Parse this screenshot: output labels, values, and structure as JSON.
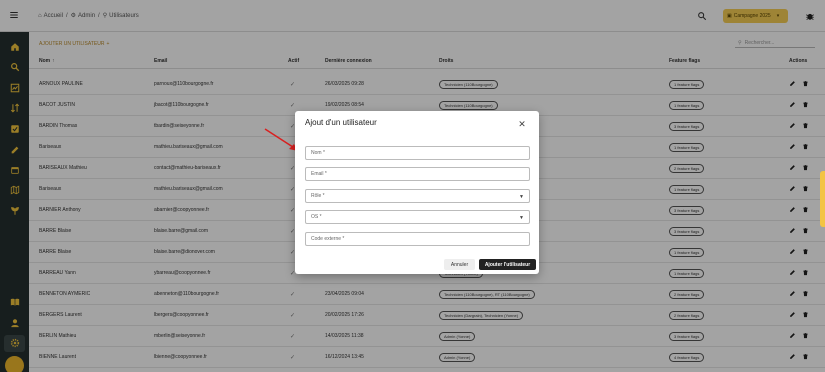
{
  "breadcrumb": {
    "home": "Accueil",
    "admin": "Admin",
    "users": "Utilisateurs"
  },
  "topbar": {
    "campaign_label": "Campagne 2025"
  },
  "toolbar": {
    "add_user_label": "AJOUTER UN UTILISATEUR",
    "search_placeholder": "Rechercher..."
  },
  "table": {
    "headers": {
      "name": "Nom",
      "email": "Email",
      "active": "Actif",
      "last_login": "Dernière connexion",
      "rights": "Droits",
      "flags": "Feature flags",
      "actions": "Actions"
    },
    "rows": [
      {
        "name": "ARNOUX PAULINE",
        "email": "parnoux@110bourgogne.fr",
        "active": "✓",
        "last_login": "26/03/2025 09:28",
        "rights": [
          "Technicien (110Bourgogne)"
        ],
        "flags": "1 feature flags"
      },
      {
        "name": "BACOT JUSTIN",
        "email": "jbacot@110bourgogne.fr",
        "active": "✓",
        "last_login": "19/02/2025 08:54",
        "rights": [
          "Technicien (110Bourgogne)"
        ],
        "flags": "1 feature flags"
      },
      {
        "name": "BARDIN Thomas",
        "email": "tbardin@seiseyonne.fr",
        "active": "✓",
        "last_login": "",
        "rights": [],
        "flags": "3 feature flags"
      },
      {
        "name": "Bariseaux",
        "email": "mathieu.bariseaux@gmail.com",
        "active": "✓",
        "last_login": "",
        "rights": [],
        "flags": "1 feature flags"
      },
      {
        "name": "BARISEAUX Mathieu",
        "email": "contact@mathieu-bariseaux.fr",
        "active": "✓",
        "last_login": "",
        "rights": [],
        "flags": "2 feature flags"
      },
      {
        "name": "Bariseaux",
        "email": "mathieu.bariseaux@gmail.com",
        "active": "✓",
        "last_login": "",
        "rights": [],
        "flags": "1 feature flags"
      },
      {
        "name": "BARNIER Anthony",
        "email": "abarnier@coopyonnee.fr",
        "active": "✓",
        "last_login": "",
        "rights": [],
        "flags": "3 feature flags"
      },
      {
        "name": "BARRE Blaise",
        "email": "blaise.barre@gmail.com",
        "active": "✓",
        "last_login": "",
        "rights": [],
        "flags": "3 feature flags"
      },
      {
        "name": "BARRE Blaise",
        "email": "blaise.barre@dionover.com",
        "active": "✓",
        "last_login": "",
        "rights": [],
        "flags": "1 feature flags"
      },
      {
        "name": "BARREAU Yann",
        "email": "ybarreau@coopyonnee.fr",
        "active": "✓",
        "last_login": "",
        "rights": [
          "Technicien (Yonne)"
        ],
        "flags": "1 feature flags"
      },
      {
        "name": "BENNETON AYMERIC",
        "email": "abenneton@110bourgogne.fr",
        "active": "✓",
        "last_login": "23/04/2025 09:04",
        "rights": [
          "Technicien (110Bourgogne), RT (110Bourgogne)"
        ],
        "flags": "2 feature flags"
      },
      {
        "name": "BERGERS Laurent",
        "email": "lbergers@coopyonnee.fr",
        "active": "✓",
        "last_login": "20/02/2025 17:26",
        "rights": [
          "Technicien (Dargrain), Technicien (Yonne)"
        ],
        "flags": "2 feature flags"
      },
      {
        "name": "BERLIN Mathieu",
        "email": "mberlin@seiseyonne.fr",
        "active": "✓",
        "last_login": "14/03/2025 11:38",
        "rights": [
          "Admin (Yonne)"
        ],
        "flags": "3 feature flags"
      },
      {
        "name": "BIENNE Laurent",
        "email": "lbienne@coopyonnee.fr",
        "active": "✓",
        "last_login": "16/12/2024 13:45",
        "rights": [
          "Admin (Yonne)"
        ],
        "flags": "4 feature flags"
      }
    ]
  },
  "modal": {
    "title": "Ajout d'un utilisateur",
    "fields": {
      "name": "Nom *",
      "email": "Email *",
      "role": "Rôle *",
      "os": "OS *",
      "external_code": "Code externe *"
    },
    "cancel_label": "Annuler",
    "submit_label": "Ajouter l'utilisateur"
  },
  "colors": {
    "sidebar": "#243030",
    "accent": "#f7cf55",
    "overlay": "rgba(0,0,0,0.36)",
    "arrow": "#d92020"
  }
}
